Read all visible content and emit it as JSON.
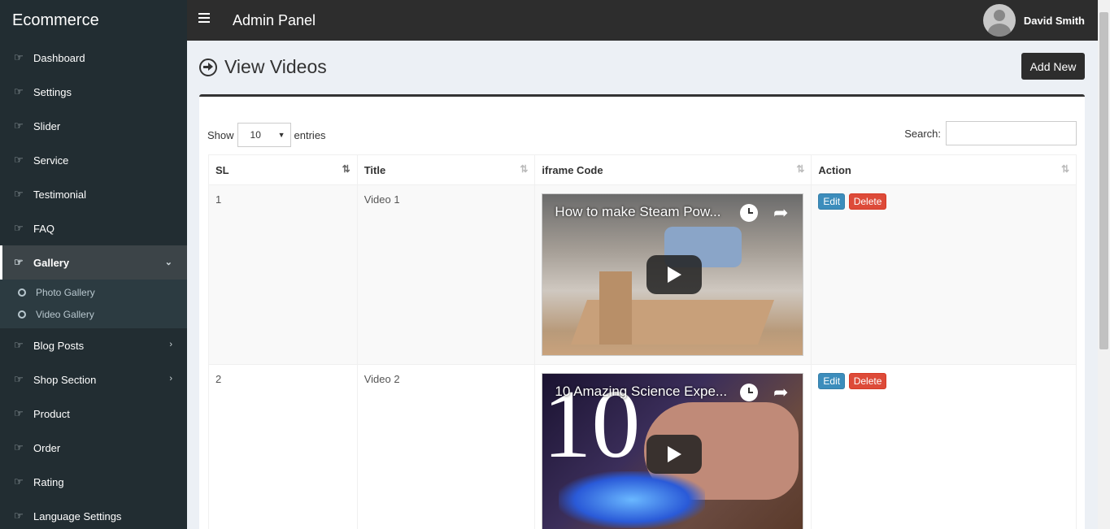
{
  "brand": "Ecommerce",
  "header": {
    "title": "Admin Panel",
    "user_name": "David Smith"
  },
  "sidebar": {
    "items": [
      {
        "label": "Dashboard"
      },
      {
        "label": "Settings"
      },
      {
        "label": "Slider"
      },
      {
        "label": "Service"
      },
      {
        "label": "Testimonial"
      },
      {
        "label": "FAQ"
      },
      {
        "label": "Gallery"
      },
      {
        "label": "Blog Posts"
      },
      {
        "label": "Shop Section"
      },
      {
        "label": "Product"
      },
      {
        "label": "Order"
      },
      {
        "label": "Rating"
      },
      {
        "label": "Language Settings"
      }
    ],
    "gallery_sub": [
      {
        "label": "Photo Gallery"
      },
      {
        "label": "Video Gallery"
      }
    ]
  },
  "page": {
    "title": "View Videos",
    "add_button": "Add New"
  },
  "table": {
    "show_label": "Show",
    "entries_value": "10",
    "entries_label": "entries",
    "search_label": "Search:",
    "columns": [
      "SL",
      "Title",
      "iframe Code",
      "Action"
    ],
    "rows": [
      {
        "sl": "1",
        "title": "Video 1",
        "video_title": "How to make Steam Pow...",
        "edit": "Edit",
        "delete": "Delete"
      },
      {
        "sl": "2",
        "title": "Video 2",
        "video_title": "10 Amazing Science Expe...",
        "edit": "Edit",
        "delete": "Delete"
      }
    ]
  },
  "icons": {
    "nav": "hand-point-right-icon",
    "menu": "hamburger-icon",
    "title": "circle-arrow-right-icon"
  }
}
